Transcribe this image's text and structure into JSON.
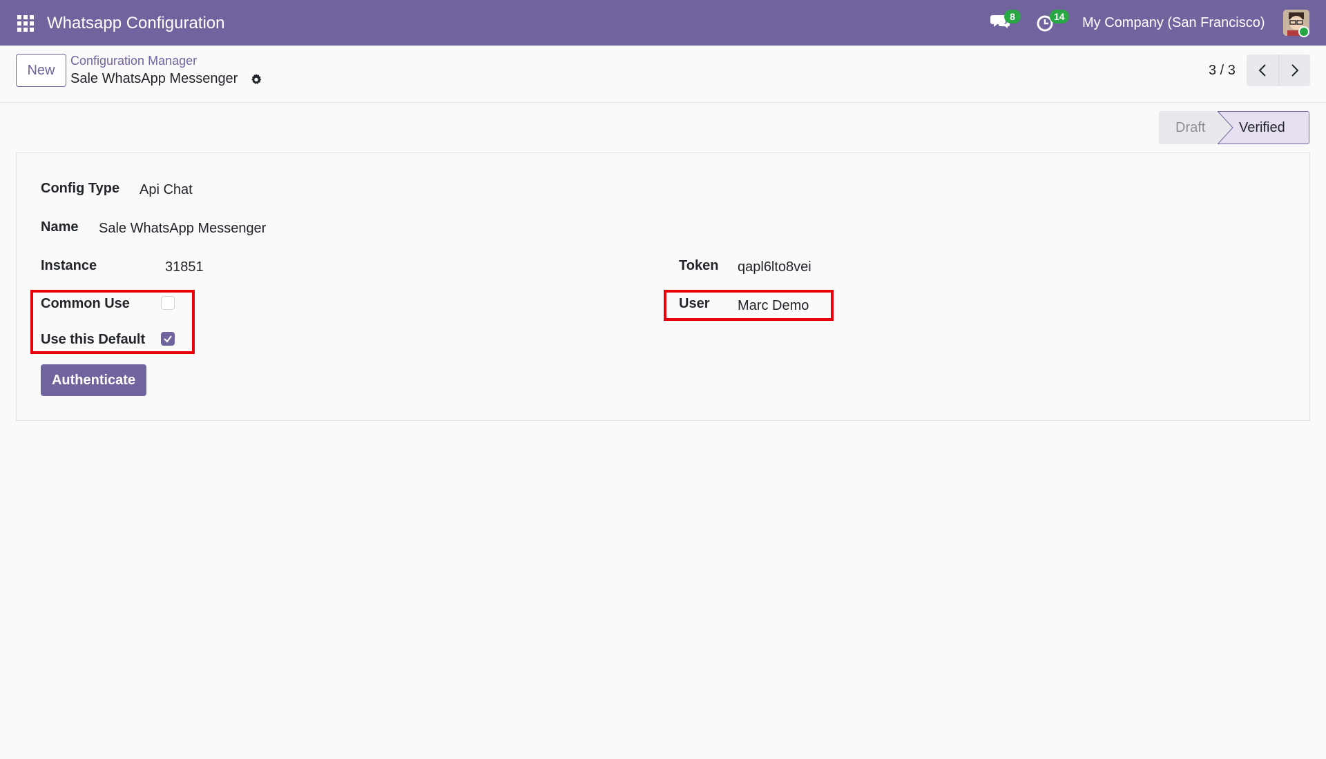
{
  "navbar": {
    "app_title": "Whatsapp Configuration",
    "messages_count": "8",
    "activities_count": "14",
    "company": "My Company (San Francisco)"
  },
  "control_panel": {
    "new_label": "New",
    "breadcrumb": "Configuration Manager",
    "record_title": "Sale WhatsApp Messenger",
    "pager": "3 / 3"
  },
  "status_bar": {
    "stages": [
      "Draft",
      "Verified"
    ],
    "active_stage": "Verified"
  },
  "form": {
    "config_type_label": "Config Type",
    "config_type_value": "Api Chat",
    "name_label": "Name",
    "name_value": "Sale WhatsApp Messenger",
    "instance_label": "Instance",
    "instance_value": "31851",
    "token_label": "Token",
    "token_value": "qapl6lto8vei",
    "common_use_label": "Common Use",
    "common_use_checked": false,
    "use_default_label": "Use this Default",
    "use_default_checked": true,
    "user_label": "User",
    "user_value": "Marc Demo",
    "authenticate_label": "Authenticate"
  },
  "colors": {
    "brand": "#71639e",
    "badge": "#28a745",
    "highlight": "#e8000b"
  }
}
